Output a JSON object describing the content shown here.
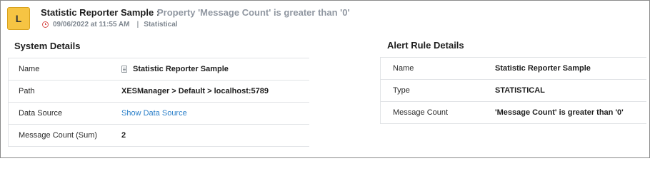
{
  "header": {
    "severity_letter": "L",
    "severity_color": "#f6c443",
    "title": "Statistic Reporter Sample :",
    "subtitle": "Property 'Message Count' is greater than '0'",
    "timestamp": "09/06/2022 at 11:55 AM",
    "separator": "|",
    "category": "Statistical",
    "timestamp_icon": "clock-icon"
  },
  "system_details": {
    "title": "System Details",
    "rows": [
      {
        "label": "Name",
        "value": "Statistic Reporter Sample",
        "icon": "document-icon"
      },
      {
        "label": "Path",
        "value": "XESManager > Default > localhost:5789"
      },
      {
        "label": "Data Source",
        "value": "Show Data Source",
        "link_color": "#2a7fc9"
      },
      {
        "label": "Message Count (Sum)",
        "value": "2"
      }
    ]
  },
  "alert_rule_details": {
    "title": "Alert Rule Details",
    "rows": [
      {
        "label": "Name",
        "value": "Statistic Reporter Sample"
      },
      {
        "label": "Type",
        "value": "STATISTICAL"
      },
      {
        "label": "Message Count",
        "value": "'Message Count' is greater than '0'"
      }
    ]
  }
}
